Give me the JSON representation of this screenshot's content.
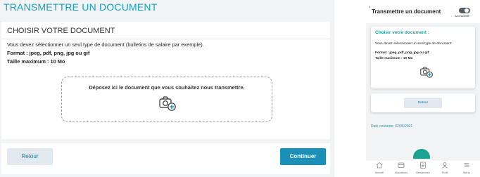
{
  "desktop": {
    "title": "TRANSMETTRE UN DOCUMENT",
    "card_title": "CHOISIR VOTRE DOCUMENT",
    "description": "Vous devez sélectionner un seul type de document (bulletins de salaire par exemple).",
    "format": "Format : jpeg, pdf, png, jpg ou gif",
    "size": "Taille maximum : 10 Mo",
    "dropzone_text": "Déposez ici le document que vous souhaitez nous transmettre.",
    "back_label": "Retour",
    "continue_label": "Continuer"
  },
  "mobile": {
    "back_glyph": "‹",
    "title": "Transmettre un document",
    "accessibility_label": "Accessibilité",
    "card_title": "Choisir votre document :",
    "description": "Vous devez sélectionner un seul type de document",
    "format": "Format : jpeg, pdf, png, jpg ou gif",
    "size": "Taille maximum : 10 Mo",
    "back_label": "Retour",
    "date_text": "Date courante: 02/06/2021",
    "nav": [
      {
        "label": "Accueil",
        "icon": "home-icon"
      },
      {
        "label": "Allocations",
        "icon": "allocations-icon"
      },
      {
        "label": "Démarches",
        "icon": "demarches-icon"
      },
      {
        "label": "Profil",
        "icon": "profile-icon"
      },
      {
        "label": "Menu",
        "icon": "menu-icon"
      }
    ]
  },
  "colors": {
    "accent_blue": "#12a2bf",
    "button_blue": "#1a8fb8",
    "mobile_teal": "#1aa39a"
  }
}
